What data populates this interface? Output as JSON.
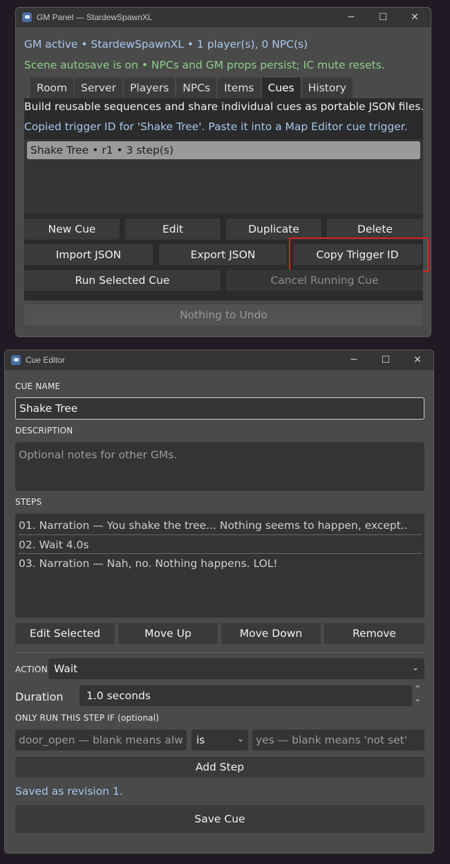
{
  "gm_window": {
    "title": "GM Panel — StardewSpawnXL",
    "status_line": "GM active • StardewSpawnXL • 1 player(s), 0 NPC(s)",
    "autosave_line": "Scene autosave is on • NPCs and GM props persist; IC mute resets.",
    "tabs": [
      "Room",
      "Server",
      "Players",
      "NPCs",
      "Items",
      "Cues",
      "History"
    ],
    "active_tab": "Cues",
    "description": "Build reusable sequences and share individual cues as portable JSON files.",
    "info_message": "Copied trigger ID for 'Shake Tree'. Paste it into a Map Editor cue trigger.",
    "cue_list": [
      "Shake Tree  •  r1  •  3 step(s)"
    ],
    "buttons": {
      "new_cue": "New Cue",
      "edit": "Edit",
      "duplicate": "Duplicate",
      "delete": "Delete",
      "import_json": "Import JSON",
      "export_json": "Export JSON",
      "copy_trigger_id": "Copy Trigger ID",
      "run_selected_cue": "Run Selected Cue",
      "cancel_running_cue": "Cancel Running Cue",
      "undo": "Nothing to Undo"
    }
  },
  "cue_editor": {
    "title": "Cue Editor",
    "cue_name_label": "CUE NAME",
    "cue_name_value": "Shake Tree",
    "description_label": "DESCRIPTION",
    "description_placeholder": "Optional notes for other GMs.",
    "steps_label": "STEPS",
    "steps": [
      "01. Narration — You shake the tree... Nothing seems to happen, except..",
      "02. Wait 4.0s",
      "03. Narration — Nah, no. Nothing happens. LOL!"
    ],
    "step_buttons": {
      "edit_selected": "Edit Selected",
      "move_up": "Move Up",
      "move_down": "Move Down",
      "remove": "Remove"
    },
    "action_label": "ACTION",
    "action_value": "Wait",
    "duration_label": "Duration",
    "duration_value": "1.0  seconds",
    "condition_label": "ONLY RUN THIS STEP IF (optional)",
    "condition_key_placeholder": "door_open — blank means alw",
    "condition_op_value": "is",
    "condition_value_placeholder": "yes — blank means 'not set'",
    "add_step": "Add Step",
    "saved_message": "Saved as revision 1.",
    "save_cue": "Save Cue"
  },
  "window_controls": {
    "minimize": "─",
    "maximize": "☐",
    "close": "✕"
  },
  "colors": {
    "highlight_box": "#e01f1f",
    "info_text": "#a9c7ec",
    "autosave_text": "#8fcf8b"
  }
}
